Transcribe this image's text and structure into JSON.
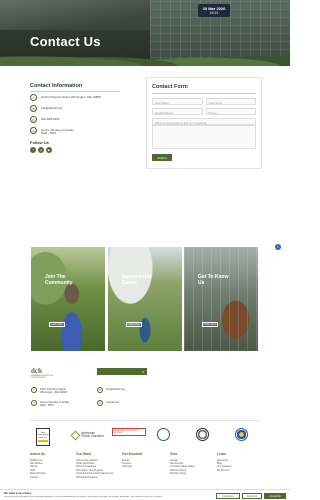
{
  "hero": {
    "title": "Contact Us"
  },
  "datetime": {
    "date": "30 Mar 2026",
    "time": "19:21"
  },
  "contact_info": {
    "heading": "Contact Information",
    "address": "1010 N Dupont Street Wilmington, DE 19808",
    "email": "info@dcbotf.org",
    "phone": "302-658-6262",
    "hours_line1": "Hours: Monday to Friday",
    "hours_line2": "9AM - 5PM",
    "follow_label": "Follow Us"
  },
  "contact_form": {
    "heading": "Contact Form",
    "first_name": "First Name",
    "last_name": "Last Name",
    "email": "Email Address",
    "phone": "Phone",
    "question": "What would you like to ask us? (required)",
    "submit": "Submit"
  },
  "cards": [
    {
      "title_line1": "Join The",
      "title_line2": "Community",
      "button": "Learn More"
    },
    {
      "title_line1": "Support Our",
      "title_line2": "Cause",
      "button": "Learn More"
    },
    {
      "title_line1": "Get To Know",
      "title_line2": "Us",
      "button": "Learn More"
    }
  ],
  "footer": {
    "logo_mark": "dch",
    "logo_sub": "DELAWARE CENTER FOR HORTICULTURE",
    "address": "1010 N Dupont Street Wilmington, DE 19808",
    "email": "info@dcbotf.org",
    "hours_line1": "Hours: Monday to Friday",
    "hours_line2": "9AM - 5PM",
    "contact_us": "Contact Us"
  },
  "partners": {
    "badge": "Best Nonprofits to Work For",
    "apg_line1": "American",
    "apg_line2": "Public Gardens",
    "red": "DELAWARE NONPROFIT CENTER"
  },
  "link_columns": [
    {
      "heading": "About Us",
      "links": [
        "DirdDcirvce",
        "Our Mission",
        "History",
        "Staff",
        "Board Member",
        "Careers"
      ]
    },
    {
      "heading": "Our Work",
      "links": [
        "Community Gardens",
        "Urban Agriculture",
        "Public Landscapes",
        "Wilmington Tree Program",
        "Youth Environmental Programming",
        "Workshop Programs"
      ]
    },
    {
      "heading": "Get Involved",
      "links": [
        "Events",
        "Courses",
        "Volunteer"
      ]
    },
    {
      "heading": "Give",
      "links": [
        "Donate",
        "Membership",
        "Corporate Partnerships",
        "Planned Giving",
        "Monthly Giving"
      ]
    },
    {
      "heading": "Learn",
      "links": [
        "Resources",
        "Blog",
        "The Gardener",
        "My Account"
      ]
    }
  ],
  "cookie": {
    "title": "We value your privacy",
    "text": "We use cookies to enhance your browsing experience, serve personalized ads or content, and analyze our traffic. By clicking \"Accept All\", you consent to our use of cookies.",
    "customize": "Customize",
    "reject": "Reject All",
    "accept": "Accept All"
  },
  "colors": {
    "brand_green": "#4e6b2f",
    "dark_heading": "#2e3d2a",
    "chat_blue": "#2a63d8"
  },
  "icons": [
    "location-icon",
    "email-icon",
    "phone-icon",
    "clock-icon",
    "facebook-icon",
    "instagram-icon",
    "youtube-icon",
    "chat-icon",
    "arrow-right-icon"
  ]
}
